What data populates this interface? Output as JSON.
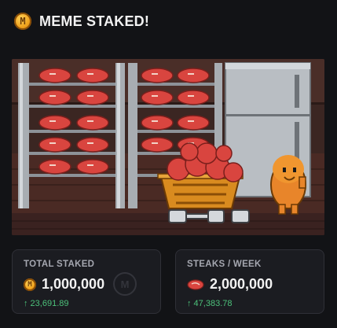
{
  "header": {
    "title": "MEME STAKED!",
    "icon": "meme-coin-icon"
  },
  "illustration": {
    "description_icon": "pixel-art-steak-cellar",
    "colors": {
      "brick": "#3a2520",
      "steak": "#d9453f",
      "steel": "#9aa0a6"
    }
  },
  "stats": {
    "total_staked": {
      "label": "TOTAL STAKED",
      "value": "1,000,000",
      "delta": "↑ 23,691.89",
      "icon": "meme-coin-icon"
    },
    "steaks_per_week": {
      "label": "STEAKS / WEEK",
      "value": "2,000,000",
      "delta": "↑ 47,383.78",
      "icon": "steak-icon"
    }
  },
  "colors": {
    "accent_green": "#4cc17a",
    "background": "#121316",
    "card": "#1b1c21"
  }
}
